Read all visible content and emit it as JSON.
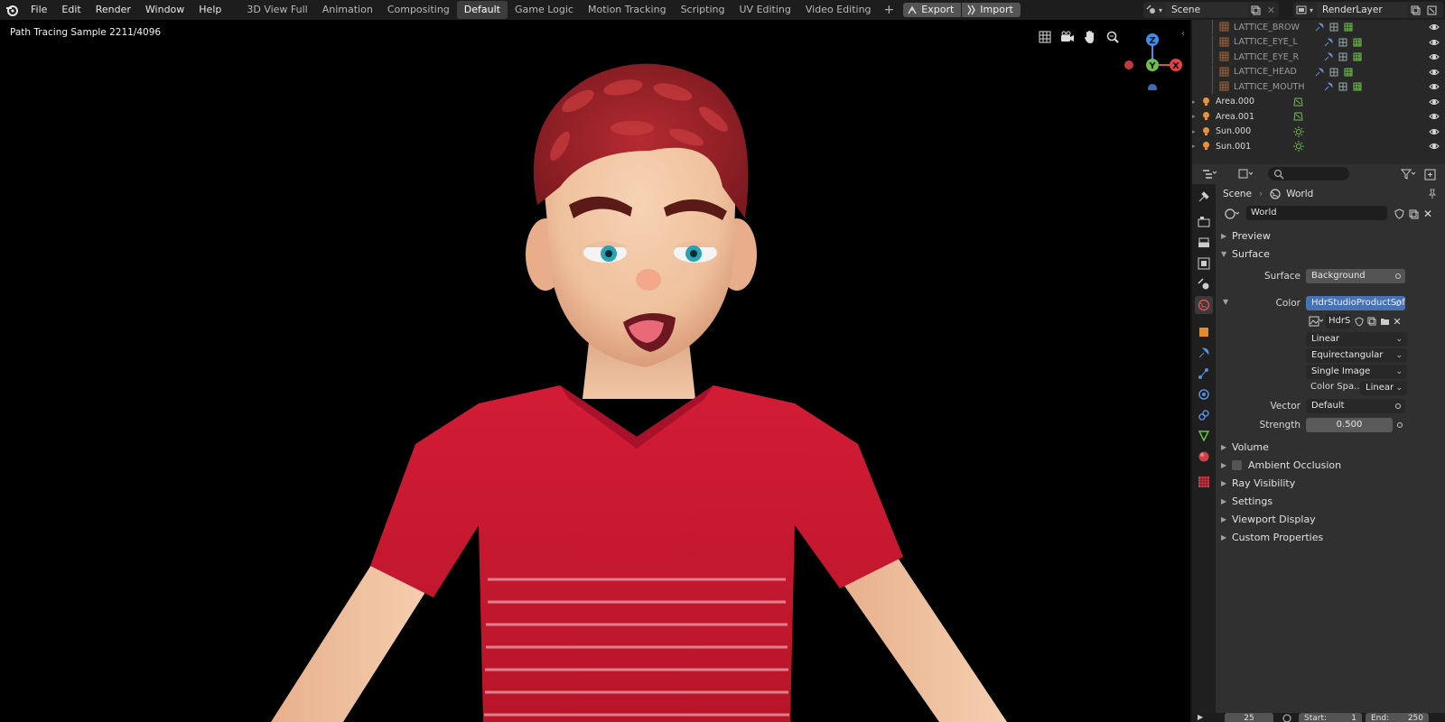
{
  "menu": {
    "items": [
      "File",
      "Edit",
      "Render",
      "Window",
      "Help"
    ]
  },
  "workspaces": {
    "tabs": [
      "3D View Full",
      "Animation",
      "Compositing",
      "Default",
      "Game Logic",
      "Motion Tracking",
      "Scripting",
      "UV Editing",
      "Video Editing"
    ],
    "active": "Default"
  },
  "toolbar": {
    "export_label": "Export",
    "import_label": "Import"
  },
  "scene_selector": {
    "value": "Scene"
  },
  "render_layer": {
    "value": "RenderLayer"
  },
  "viewport": {
    "info_text": "Path Tracing Sample 2211/4096",
    "gizmo": {
      "z": "Z",
      "y": "Y",
      "x": "X"
    }
  },
  "outliner": {
    "rows": [
      {
        "name": "LATTICE_BROW",
        "type": "lattice"
      },
      {
        "name": "LATTICE_EYE_L",
        "type": "lattice"
      },
      {
        "name": "LATTICE_EYE_R",
        "type": "lattice"
      },
      {
        "name": "LATTICE_HEAD",
        "type": "lattice"
      },
      {
        "name": "LATTICE_MOUTH",
        "type": "lattice"
      },
      {
        "name": "Area.000",
        "type": "area"
      },
      {
        "name": "Area.001",
        "type": "area"
      },
      {
        "name": "Sun.000",
        "type": "sun"
      },
      {
        "name": "Sun.001",
        "type": "sun"
      }
    ]
  },
  "properties": {
    "breadcrumb": {
      "scene": "Scene",
      "world": "World"
    },
    "world_name": "World",
    "panels": {
      "preview": "Preview",
      "surface": "Surface",
      "volume": "Volume",
      "ambient_occlusion": "Ambient Occlusion",
      "ray_visibility": "Ray Visibility",
      "settings": "Settings",
      "viewport_display": "Viewport Display",
      "custom_properties": "Custom Properties"
    },
    "surface": {
      "surface_label": "Surface",
      "surface_value": "Background",
      "color_label": "Color",
      "color_value": "HdrStudioProductSof...",
      "image_name": "HdrS",
      "interpolation": "Linear",
      "projection": "Equirectangular",
      "source": "Single Image",
      "color_space_label": "Color Spa..",
      "color_space_value": "Linear",
      "vector_label": "Vector",
      "vector_value": "Default",
      "strength_label": "Strength",
      "strength_value": "0.500"
    }
  },
  "timeline": {
    "current_frame": "25",
    "start_label": "Start:",
    "start_value": "1",
    "end_label": "End:",
    "end_value": "250"
  },
  "colors": {
    "accent_blue": "#4772b3",
    "active_tab": "#3d3d3d",
    "shirt_red": "#c4182d",
    "hair_red": "#a8222a"
  }
}
